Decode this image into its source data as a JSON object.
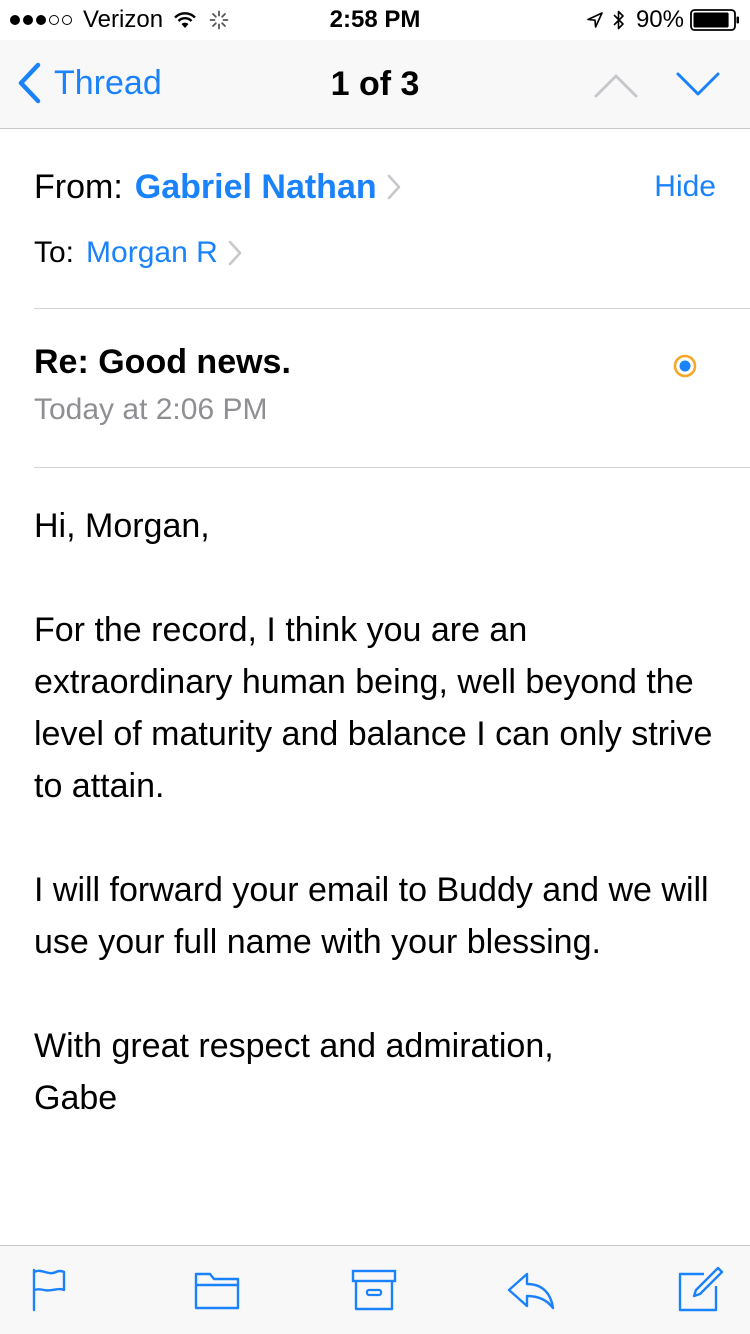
{
  "status_bar": {
    "carrier": "Verizon",
    "signal_bars_filled": 3,
    "signal_bars_total": 5,
    "time": "2:58 PM",
    "battery_percent": "90%",
    "battery_level": 0.9
  },
  "nav": {
    "back_label": "Thread",
    "title": "1 of 3"
  },
  "header": {
    "from_label": "From:",
    "from_name": "Gabriel Nathan",
    "hide_label": "Hide",
    "to_label": "To:",
    "to_name": "Morgan R"
  },
  "message": {
    "subject": "Re: Good news.",
    "date": "Today at 2:06 PM",
    "body": {
      "greeting": "Hi, Morgan,",
      "paragraph_1": "For the record, I think you are an extraordinary human being, well beyond the level of maturity and balance I can only strive to attain.",
      "paragraph_2": "I will forward your email to Buddy and we will use your full name with your blessing.",
      "closing": "With great respect and admiration,",
      "signature": "Gabe"
    }
  },
  "colors": {
    "accent": "#1a82fb",
    "secondary_text": "#8e8e93",
    "unread_ring": "#f5a623"
  },
  "icons": {
    "flag": "flag-icon",
    "folder": "folder-icon",
    "archive": "archive-icon",
    "reply": "reply-icon",
    "compose": "compose-icon"
  }
}
